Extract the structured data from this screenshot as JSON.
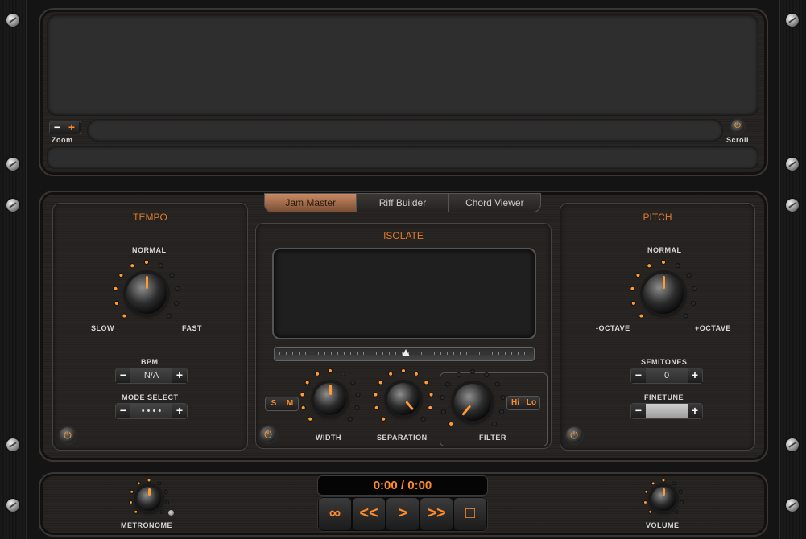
{
  "waveform": {
    "zoom_label": "Zoom",
    "scroll_label": "Scroll",
    "minus": "−",
    "plus": "+"
  },
  "tabs": [
    {
      "label": "Jam Master",
      "active": true
    },
    {
      "label": "Riff Builder",
      "active": false
    },
    {
      "label": "Chord Viewer",
      "active": false
    }
  ],
  "tempo": {
    "title": "TEMPO",
    "normal": "NORMAL",
    "slow": "SLOW",
    "fast": "FAST",
    "bpm_label": "BPM",
    "bpm_value": "N/A",
    "mode_label": "MODE SELECT",
    "mode_value": "• • • •"
  },
  "isolate": {
    "title": "ISOLATE",
    "s_label": "S",
    "m_label": "M",
    "width_label": "WIDTH",
    "separation_label": "SEPARATION",
    "filter_label": "FILTER",
    "hi_label": "Hi",
    "lo_label": "Lo"
  },
  "pitch": {
    "title": "PITCH",
    "normal": "NORMAL",
    "minus_octave": "-OCTAVE",
    "plus_octave": "+OCTAVE",
    "semitones_label": "SEMITONES",
    "semitones_value": "0",
    "finetune_label": "FINETUNE",
    "finetune_value": ""
  },
  "transport": {
    "time": "0:00 / 0:00",
    "loop": "∞",
    "rewind": "<<",
    "play": ">",
    "forward": ">>",
    "stop": "□",
    "metronome_label": "METRONOME",
    "volume_label": "VOLUME"
  },
  "colors": {
    "accent": "#e07a2c",
    "led": "#ff9b33",
    "tab_active": "#b57552"
  }
}
